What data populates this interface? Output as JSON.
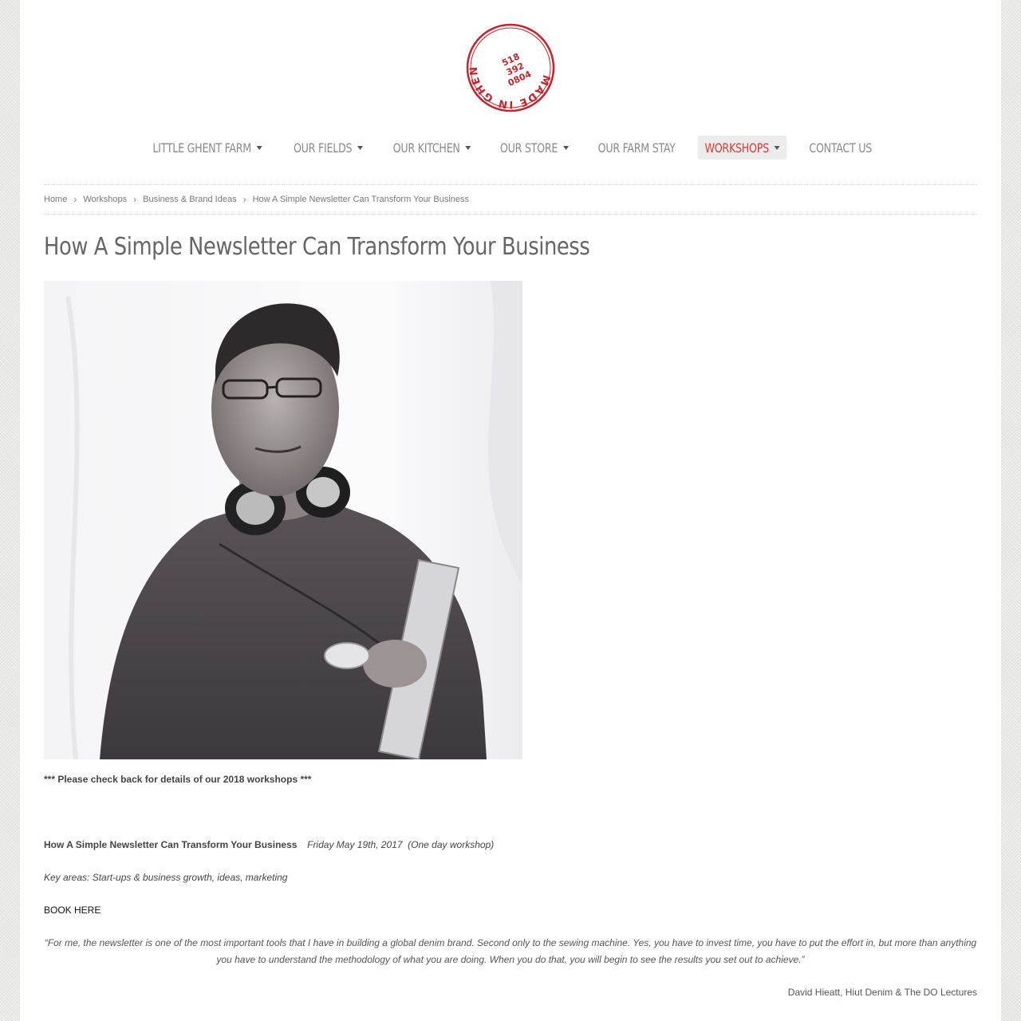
{
  "logo": {
    "ring_text": "MADE IN GHENT, NY",
    "phone_lines": [
      "518",
      "392",
      "0804"
    ],
    "color": "#c8232c"
  },
  "nav": {
    "items": [
      {
        "label": "LITTLE GHENT FARM",
        "has_dropdown": true,
        "active": false
      },
      {
        "label": "OUR FIELDS",
        "has_dropdown": true,
        "active": false
      },
      {
        "label": "OUR KITCHEN",
        "has_dropdown": true,
        "active": false
      },
      {
        "label": "OUR STORE",
        "has_dropdown": true,
        "active": false
      },
      {
        "label": "OUR FARM STAY",
        "has_dropdown": false,
        "active": false
      },
      {
        "label": "WORKSHOPS",
        "has_dropdown": true,
        "active": true
      },
      {
        "label": "CONTACT US",
        "has_dropdown": false,
        "active": false
      }
    ],
    "active_color": "#e03a32"
  },
  "breadcrumb": {
    "items": [
      "Home",
      "Workshops",
      "Business & Brand Ideas",
      "How A Simple Newsletter Can Transform Your Business"
    ]
  },
  "page": {
    "title": "How A Simple Newsletter Can Transform Your Business",
    "notice": "*** Please check back for details of our 2018 workshops ***",
    "event_title": "How A Simple Newsletter Can Transform Your Business",
    "event_date": "Friday May 19th, 2017  (One day workshop)",
    "key_areas": "Key areas: Start-ups & business growth, ideas, marketing",
    "book_link": "BOOK HERE",
    "quote": "“For me, the newsletter is one of the most important tools that I have in building a global denim brand. Second only to the sewing machine. Yes, you have to invest time, you have to put the effort in, but more than anything you have to understand the methodology of what you are doing. When you do that, you will begin to see the results you set out to achieve.”",
    "attribution": "David Hieatt, Hiut Denim & The DO Lectures"
  }
}
